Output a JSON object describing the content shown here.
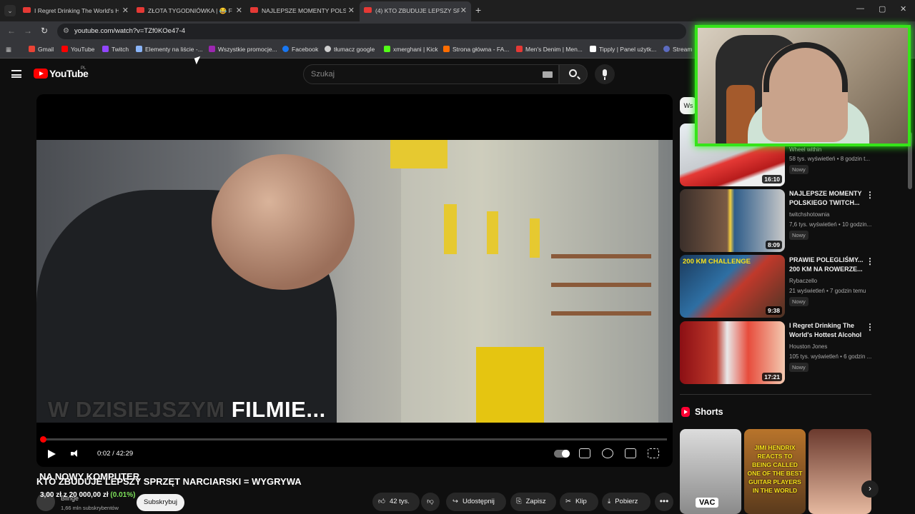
{
  "browser": {
    "tabs": [
      {
        "title": "I Regret Drinking The World's H"
      },
      {
        "title": "ZŁOTA TYGODNIÓWKA | 😂 FU"
      },
      {
        "title": "NAJLEPSZE MOMENTY POLSKI"
      },
      {
        "title": "(4) KTO ZBUDUJE LEPSZY SPRZ"
      }
    ],
    "url": "youtube.com/watch?v=TZf0KOe47-4",
    "bookmarks": [
      {
        "label": "Gmail",
        "color": "#ea4335"
      },
      {
        "label": "YouTube",
        "color": "#ff0000"
      },
      {
        "label": "Twitch",
        "color": "#9146ff"
      },
      {
        "label": "Elementy na liście -...",
        "color": "#8ab4f8"
      },
      {
        "label": "Wszystkie promocje...",
        "color": "#9c27b0"
      },
      {
        "label": "Facebook",
        "color": "#1877f2"
      },
      {
        "label": "tłumacz google",
        "color": "#cfcfcf"
      },
      {
        "label": "xmerghani | Kick",
        "color": "#53fc18"
      },
      {
        "label": "Strona główna - FA...",
        "color": "#ff6d00"
      },
      {
        "label": "Men's Denim | Men...",
        "color": "#e53935"
      },
      {
        "label": "Tipply | Panel użytk...",
        "color": "#ffffff"
      },
      {
        "label": "Stream",
        "color": "#5c6bc0"
      }
    ]
  },
  "youtube": {
    "logo_text": "YouTube",
    "country_code": "PL",
    "search_placeholder": "Szukaj"
  },
  "player": {
    "subtitle_dim": "W DZISIEJSZYM ",
    "subtitle_bright": "FILMIE...",
    "time": "0:02 / 42:29",
    "progress_fraction": 0.0008
  },
  "video": {
    "overlay_title": "NA NOWY KOMPUTER",
    "title": "KTO ZBUDUJE LEPSZY SPRZĘT NARCIARSKI = WYGRYWA",
    "donation": "3,00 zł z 20 000,00 zł",
    "donation_pct": "(0.01%)",
    "channel": "Bilnge",
    "subscribers": "1,66 mln subskrybentów",
    "subscribe_label": "Subskrybuj",
    "actions": {
      "likes": "42 tys.",
      "share": "Udostępnij",
      "save": "Zapisz",
      "clip": "Klip",
      "download": "Pobierz"
    }
  },
  "sidebar": {
    "chip": "Ws",
    "recommendations": [
      {
        "title": "",
        "channel": "Wheel within",
        "meta": "58 tys. wyświetleń • 8 godzin t...",
        "badge": "Nowy",
        "duration": "16:10"
      },
      {
        "title": "NAJLEPSZE MOMENTY POLSKIEGO TWITCH...",
        "channel": "twitchshotownia",
        "meta": "7,6 tys. wyświetleń • 10 godzin...",
        "badge": "Nowy",
        "duration": "8:09"
      },
      {
        "title": "PRAWIE POLEGLIŚMY... 200 KM NA ROWERZE...",
        "channel": "Rybaczello",
        "meta": "21 wyświetleń • 7 godzin temu",
        "badge": "Nowy",
        "duration": "9:38",
        "thumb_text": "200 KM CHALLENGE"
      },
      {
        "title": "I Regret Drinking The World's Hottest Alcohol",
        "channel": "Houston Jones",
        "meta": "105 tys. wyświetleń • 6 godzin ...",
        "badge": "Nowy",
        "duration": "17:21"
      }
    ],
    "shorts_label": "Shorts",
    "shorts": [
      {
        "caption": "VAC"
      },
      {
        "caption": "JIMI HENDRIX REACTS TO BEING CALLED ONE OF THE BEST GUITAR PLAYERS IN THE WORLD"
      },
      {
        "caption": ""
      }
    ]
  }
}
